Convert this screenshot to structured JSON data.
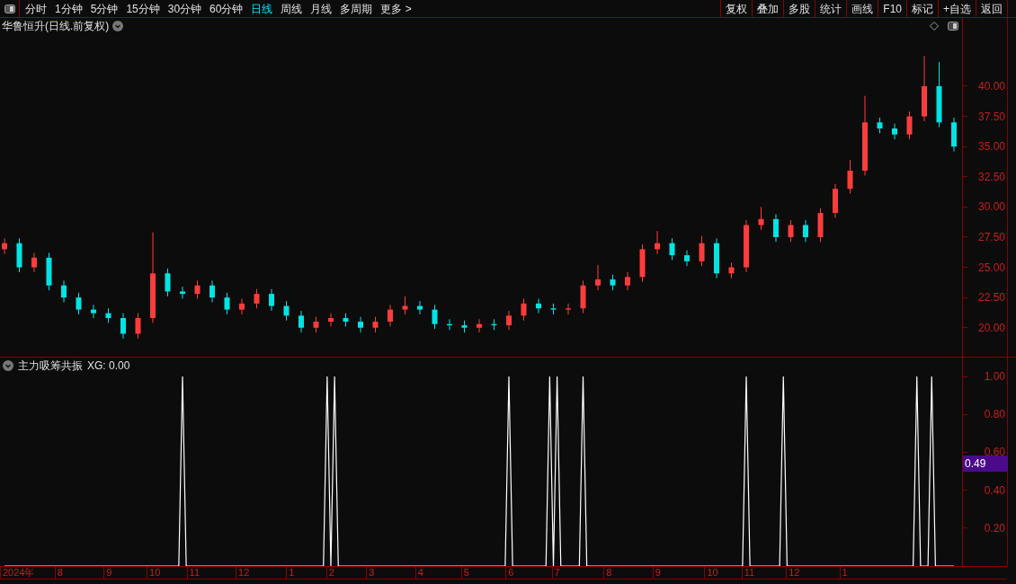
{
  "toolbar": {
    "tabs": [
      {
        "label": "分时",
        "selected": false
      },
      {
        "label": "1分钟",
        "selected": false
      },
      {
        "label": "5分钟",
        "selected": false
      },
      {
        "label": "15分钟",
        "selected": false
      },
      {
        "label": "30分钟",
        "selected": false
      },
      {
        "label": "60分钟",
        "selected": false
      },
      {
        "label": "日线",
        "selected": true
      },
      {
        "label": "周线",
        "selected": false
      },
      {
        "label": "月线",
        "selected": false
      },
      {
        "label": "多周期",
        "selected": false
      },
      {
        "label": "更多 >",
        "selected": false
      }
    ],
    "buttons": [
      "复权",
      "叠加",
      "多股",
      "统计",
      "画线",
      "F10",
      "标记",
      "+自选",
      "返回"
    ]
  },
  "price_panel": {
    "title": "华鲁恒升(日线.前复权)",
    "chart_data": {
      "type": "candlestick",
      "categories": [
        null,
        null,
        null,
        null,
        null,
        null,
        null,
        null,
        null,
        null,
        null,
        null,
        null,
        null,
        null,
        null,
        null,
        null,
        null,
        null,
        null,
        null,
        null,
        null,
        null,
        null,
        null,
        null,
        null,
        null,
        null,
        null,
        null,
        null,
        null,
        null,
        null,
        null,
        null,
        null,
        null,
        null,
        null,
        null,
        null,
        null,
        null,
        null,
        null,
        null,
        null,
        null,
        null,
        null,
        null,
        null,
        null,
        null,
        null,
        null,
        null,
        null,
        null,
        null,
        null
      ],
      "ohlc": [
        [
          26.5,
          27.4,
          26.1,
          27
        ],
        [
          27,
          27.4,
          24.6,
          25
        ],
        [
          25,
          26.2,
          24.6,
          25.8
        ],
        [
          25.8,
          26.2,
          23.1,
          23.5
        ],
        [
          23.5,
          23.9,
          22.1,
          22.5
        ],
        [
          22.5,
          22.9,
          21.1,
          21.5
        ],
        [
          21.5,
          21.9,
          20.8,
          21.2
        ],
        [
          21.2,
          21.6,
          20.4,
          20.8
        ],
        [
          20.8,
          21.2,
          19.1,
          19.5
        ],
        [
          19.5,
          21.2,
          19.1,
          20.8
        ],
        [
          20.8,
          27.9,
          20.4,
          24.5
        ],
        [
          24.5,
          24.9,
          22.6,
          23
        ],
        [
          23,
          23.4,
          22.4,
          22.8
        ],
        [
          22.8,
          23.9,
          22.4,
          23.5
        ],
        [
          23.5,
          23.9,
          22.1,
          22.5
        ],
        [
          22.5,
          22.9,
          21.1,
          21.5
        ],
        [
          21.5,
          22.4,
          21.1,
          22
        ],
        [
          22,
          23.2,
          21.6,
          22.8
        ],
        [
          22.8,
          23.2,
          21.4,
          21.8
        ],
        [
          21.8,
          22.2,
          20.6,
          21
        ],
        [
          21,
          21.4,
          19.6,
          20
        ],
        [
          20,
          20.9,
          19.6,
          20.5
        ],
        [
          20.5,
          21.2,
          20.1,
          20.8
        ],
        [
          20.8,
          21.2,
          20.1,
          20.5
        ],
        [
          20.5,
          20.9,
          19.6,
          20
        ],
        [
          20,
          20.9,
          19.6,
          20.5
        ],
        [
          20.5,
          21.9,
          20.1,
          21.5
        ],
        [
          21.5,
          22.6,
          21.1,
          21.8
        ],
        [
          21.8,
          22.2,
          21.1,
          21.5
        ],
        [
          21.5,
          21.9,
          19.9,
          20.3
        ],
        [
          20.3,
          20.7,
          19.8,
          20.2
        ],
        [
          20.2,
          20.6,
          19.6,
          20
        ],
        [
          20,
          20.7,
          19.6,
          20.3
        ],
        [
          20.3,
          20.7,
          19.8,
          20.2
        ],
        [
          20.2,
          21.4,
          19.8,
          21
        ],
        [
          21,
          22.4,
          20.6,
          22
        ],
        [
          22,
          22.4,
          21.2,
          21.6
        ],
        [
          21.6,
          22,
          21.1,
          21.5
        ],
        [
          21.5,
          22,
          21.1,
          21.6
        ],
        [
          21.6,
          23.9,
          21.2,
          23.5
        ],
        [
          23.5,
          25.2,
          23.1,
          24
        ],
        [
          24,
          24.4,
          23.1,
          23.5
        ],
        [
          23.5,
          24.6,
          23.1,
          24.2
        ],
        [
          24.2,
          26.9,
          23.8,
          26.5
        ],
        [
          26.5,
          28,
          26.1,
          27
        ],
        [
          27,
          27.4,
          25.6,
          26
        ],
        [
          26,
          26.4,
          25.1,
          25.5
        ],
        [
          25.5,
          27.6,
          25.1,
          27
        ],
        [
          27,
          27.4,
          24.1,
          24.5
        ],
        [
          24.5,
          25.4,
          24.1,
          25
        ],
        [
          25,
          28.9,
          24.6,
          28.5
        ],
        [
          28.5,
          30,
          28.1,
          29
        ],
        [
          29,
          29.4,
          27.1,
          27.5
        ],
        [
          27.5,
          28.9,
          27.1,
          28.5
        ],
        [
          28.5,
          28.9,
          27.1,
          27.5
        ],
        [
          27.5,
          29.9,
          27.1,
          29.5
        ],
        [
          29.5,
          31.9,
          29.1,
          31.5
        ],
        [
          31.5,
          33.9,
          31.1,
          33
        ],
        [
          33,
          39.2,
          32.6,
          37
        ],
        [
          37,
          37.4,
          36.1,
          36.5
        ],
        [
          36.5,
          36.9,
          35.6,
          36
        ],
        [
          36,
          37.9,
          35.6,
          37.5
        ],
        [
          37.5,
          42.5,
          37.1,
          40
        ],
        [
          40,
          42,
          36.6,
          37
        ],
        [
          37,
          37.4,
          34.6,
          35
        ]
      ],
      "yticks": [
        {
          "value": 20,
          "label": "20.00"
        },
        {
          "value": 22.5,
          "label": "22.50"
        },
        {
          "value": 25,
          "label": "25.00"
        },
        {
          "value": 27.5,
          "label": "27.50"
        },
        {
          "value": 30,
          "label": "30.00"
        },
        {
          "value": 32.5,
          "label": "32.50"
        },
        {
          "value": 35,
          "label": "35.00"
        },
        {
          "value": 37.5,
          "label": "37.50"
        },
        {
          "value": 40,
          "label": "40.00"
        }
      ],
      "ylim": [
        17.6,
        45.65
      ]
    }
  },
  "date_axis": [
    "2024年",
    "8",
    "9",
    "10",
    "11",
    "12",
    "1",
    "2",
    "3",
    "4",
    "5",
    "6",
    "7",
    "8",
    "9",
    "10",
    "11",
    "12",
    "1"
  ],
  "indicator_panel": {
    "title": "主力吸筹共振",
    "reading": "XG: 0.00",
    "cursor_value": "0.49",
    "chart_data": {
      "type": "line",
      "ylim": [
        0,
        1.1
      ],
      "categories": [
        null,
        null,
        null,
        null,
        null,
        null,
        null,
        null,
        null,
        null,
        null,
        null,
        null,
        null,
        null,
        null,
        null,
        null,
        null,
        null,
        null,
        null,
        null,
        null,
        null,
        null,
        null,
        null,
        null,
        null,
        null,
        null,
        null,
        null,
        null,
        null,
        null,
        null,
        null,
        null,
        null,
        null,
        null,
        null,
        null,
        null,
        null,
        null,
        null,
        null,
        null,
        null,
        null,
        null,
        null,
        null,
        null,
        null,
        null,
        null,
        null,
        null,
        null,
        null,
        null,
        null,
        null,
        null,
        null,
        null,
        null,
        null,
        null,
        null,
        null,
        null,
        null,
        null,
        null,
        null,
        null,
        null,
        null,
        null,
        null,
        null,
        null,
        null,
        null,
        null,
        null,
        null,
        null,
        null,
        null,
        null,
        null,
        null,
        null,
        null,
        null,
        null,
        null,
        null,
        null,
        null,
        null,
        null,
        null,
        null,
        null,
        null,
        null,
        null,
        null,
        null,
        null,
        null,
        null,
        null,
        null,
        null,
        null,
        null,
        null,
        null,
        null,
        null,
        null,
        null,
        null,
        null,
        null,
        null,
        null,
        null,
        null,
        null,
        null,
        null,
        null,
        null,
        null,
        null,
        null,
        null,
        null,
        null,
        null,
        null,
        null,
        null,
        null,
        null,
        null,
        null,
        null,
        null,
        null,
        null,
        null,
        null,
        null,
        null,
        null,
        null,
        null,
        null,
        null,
        null,
        null,
        null,
        null,
        null,
        null,
        null,
        null,
        null,
        null,
        null,
        null,
        null,
        null,
        null,
        null,
        null,
        null,
        null,
        null,
        null,
        null,
        null,
        null,
        null,
        null,
        null,
        null,
        null,
        null,
        null,
        null,
        null,
        null,
        null,
        null,
        null,
        null,
        null,
        null,
        null,
        null,
        null,
        null,
        null,
        null,
        null,
        null,
        null,
        null,
        null,
        null,
        null,
        null,
        null,
        null,
        null,
        null,
        null,
        null,
        null,
        null,
        null,
        null,
        null,
        null,
        null,
        null,
        null,
        null,
        null,
        null,
        null,
        null,
        null,
        null,
        null,
        null,
        null,
        null,
        null,
        null,
        null,
        null,
        null,
        null,
        null,
        null
      ],
      "series": [
        {
          "color": "#ffffff",
          "values": [
            0,
            0,
            0,
            0,
            0,
            0,
            0,
            0,
            0,
            0,
            0,
            0,
            0,
            0,
            0,
            0,
            0,
            0,
            0,
            0,
            0,
            0,
            0,
            0,
            0,
            0,
            0,
            0,
            0,
            0,
            0,
            0,
            0,
            0,
            0,
            0,
            0,
            0,
            0,
            0,
            0,
            0,
            0,
            0,
            0,
            0,
            0,
            0,
            1,
            0,
            0,
            0,
            0,
            0,
            0,
            0,
            0,
            0,
            0,
            0,
            0,
            0,
            0,
            0,
            0,
            0,
            0,
            0,
            0,
            0,
            0,
            0,
            0,
            0,
            0,
            0,
            0,
            0,
            0,
            0,
            0,
            0,
            0,
            0,
            0,
            0,
            0,
            1,
            0,
            1,
            0,
            0,
            0,
            0,
            0,
            0,
            0,
            0,
            0,
            0,
            0,
            0,
            0,
            0,
            0,
            0,
            0,
            0,
            0,
            0,
            0,
            0,
            0,
            0,
            0,
            0,
            0,
            0,
            0,
            0,
            0,
            0,
            0,
            0,
            0,
            0,
            0,
            0,
            0,
            0,
            0,
            0,
            0,
            0,
            0,
            0,
            1,
            0,
            0,
            0,
            0,
            0,
            0,
            0,
            0,
            0,
            0,
            1,
            0,
            1,
            0,
            0,
            0,
            0,
            0,
            0,
            1,
            0,
            0,
            0,
            0,
            0,
            0,
            0,
            0,
            0,
            0,
            0,
            0,
            0,
            0,
            0,
            0,
            0,
            0,
            0,
            0,
            0,
            0,
            0,
            0,
            0,
            0,
            0,
            0,
            0,
            0,
            0,
            0,
            0,
            0,
            0,
            0,
            0,
            0,
            0,
            0,
            0,
            0,
            0,
            1,
            0,
            0,
            0,
            0,
            0,
            0,
            0,
            0,
            0,
            1,
            0,
            0,
            0,
            0,
            0,
            0,
            0,
            0,
            0,
            0,
            0,
            0,
            0,
            0,
            0,
            0,
            0,
            0,
            0,
            0,
            0,
            0,
            0,
            0,
            0,
            0,
            0,
            0,
            0,
            0,
            0,
            0,
            0,
            0,
            0,
            1,
            0,
            0,
            0,
            1,
            0,
            0,
            0,
            0,
            0,
            0
          ]
        }
      ],
      "yticks": [
        {
          "value": 0.2,
          "label": "0.20"
        },
        {
          "value": 0.4,
          "label": "0.40"
        },
        {
          "value": 0.6,
          "label": "0.60"
        },
        {
          "value": 0.8,
          "label": "0.80"
        },
        {
          "value": 1,
          "label": "1.00"
        }
      ]
    }
  }
}
